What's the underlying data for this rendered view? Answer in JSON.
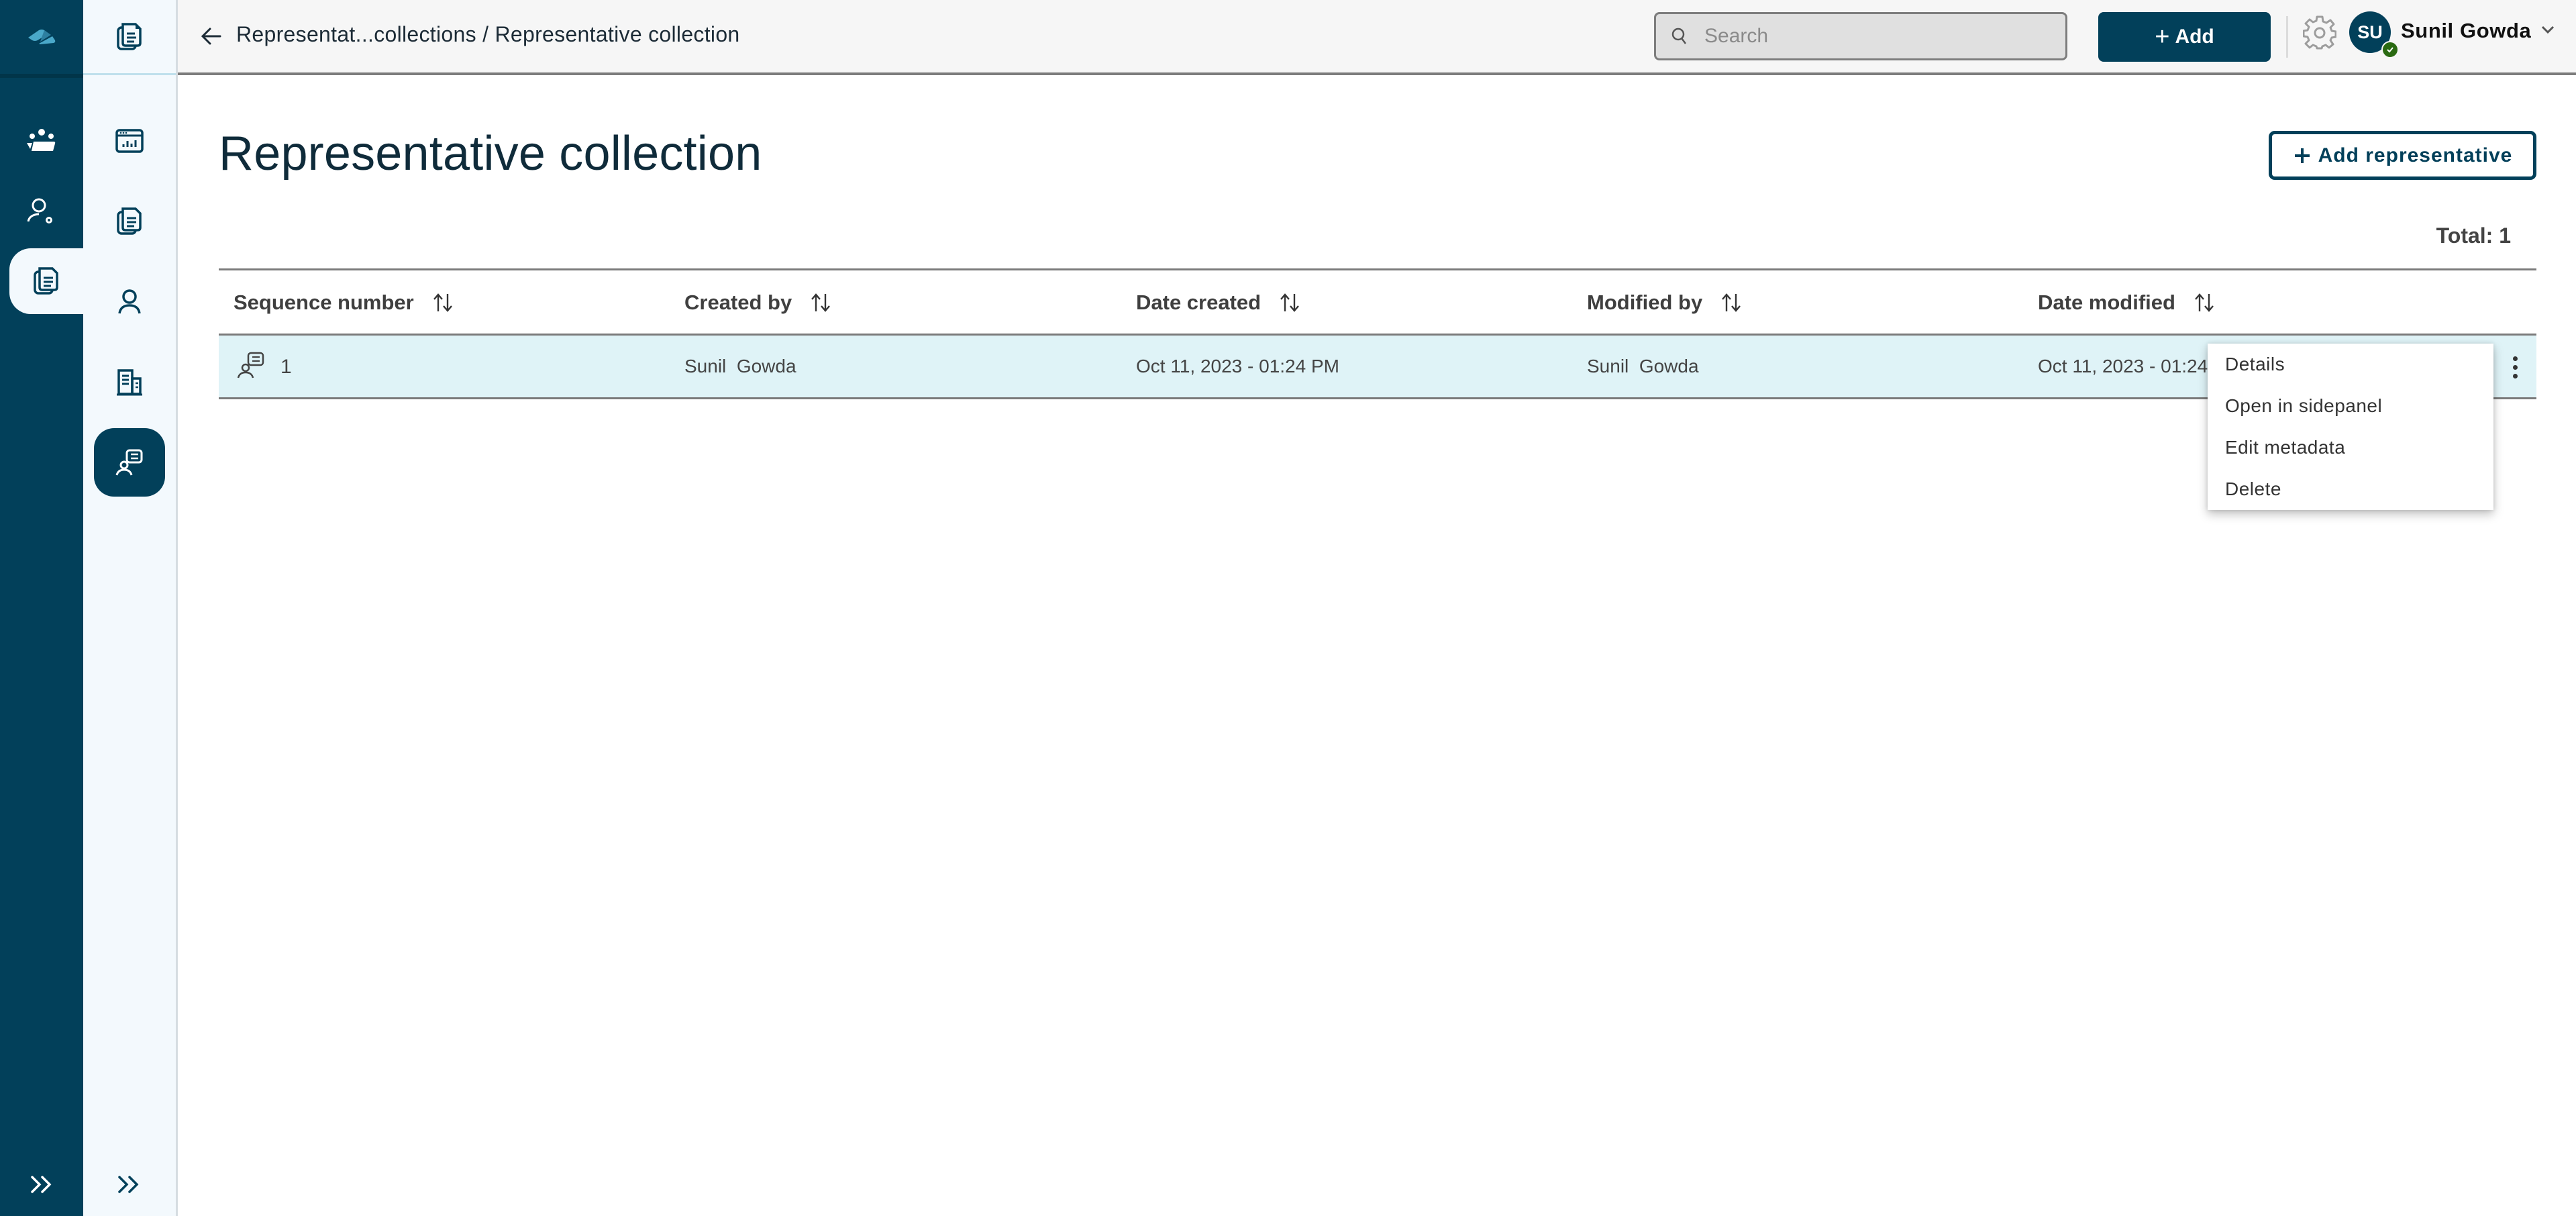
{
  "app": {
    "logo_icon": "app-logo-icon"
  },
  "rail": {
    "items": [
      {
        "name": "rail-item-groups",
        "icon": "group-icon",
        "active": false
      },
      {
        "name": "rail-item-user-admin",
        "icon": "user-settings-icon",
        "active": false
      },
      {
        "name": "rail-item-documents",
        "icon": "documents-icon",
        "active": true
      }
    ],
    "expand_icon": "double-chevron-right-icon"
  },
  "subnav": {
    "items": [
      {
        "name": "subnav-item-documents-top",
        "icon": "documents-icon",
        "active": false
      },
      {
        "name": "subnav-item-dashboard",
        "icon": "dashboard-chart-icon",
        "active": false
      },
      {
        "name": "subnav-item-documents",
        "icon": "documents-icon",
        "active": false
      },
      {
        "name": "subnav-item-person",
        "icon": "person-icon",
        "active": false
      },
      {
        "name": "subnav-item-organization",
        "icon": "building-icon",
        "active": false
      },
      {
        "name": "subnav-item-representatives",
        "icon": "representative-icon",
        "active": true
      }
    ],
    "expand_icon": "double-chevron-right-icon"
  },
  "header": {
    "back_icon": "arrow-left-icon",
    "breadcrumb": {
      "parent": "Representat...collections",
      "separator": " / ",
      "current": "Representative collection"
    },
    "search": {
      "placeholder": "Search",
      "value": ""
    },
    "add_button": {
      "plus": "+",
      "label": "Add"
    },
    "settings_icon": "gear-icon",
    "user": {
      "initials": "SU",
      "name": "Sunil Gowda",
      "status": "online"
    }
  },
  "page": {
    "title": "Representative collection",
    "add_representative": {
      "plus": "+",
      "label": "Add representative"
    },
    "total_label": "Total: 1"
  },
  "table": {
    "columns": [
      {
        "label": "Sequence number",
        "sortable": true
      },
      {
        "label": "Created by",
        "sortable": true
      },
      {
        "label": "Date created",
        "sortable": true
      },
      {
        "label": "Modified by",
        "sortable": true
      },
      {
        "label": "Date modified",
        "sortable": true
      }
    ],
    "rows": [
      {
        "sequence_number": "1",
        "created_by": "Sunil  Gowda",
        "date_created": "Oct 11, 2023 - 01:24 PM",
        "modified_by": "Sunil  Gowda",
        "date_modified": "Oct 11, 2023 - 01:24",
        "selected": true
      }
    ]
  },
  "context_menu": {
    "items": [
      {
        "label": "Details"
      },
      {
        "label": "Open in sidepanel"
      },
      {
        "label": "Edit metadata"
      },
      {
        "label": "Delete"
      }
    ]
  },
  "colors": {
    "brand_dark": "#02405a",
    "subnav_bg": "#f3f9fd",
    "selected_row": "#dff3f7",
    "header_bg": "#f6f6f6",
    "presence_online": "#2a6a12"
  }
}
